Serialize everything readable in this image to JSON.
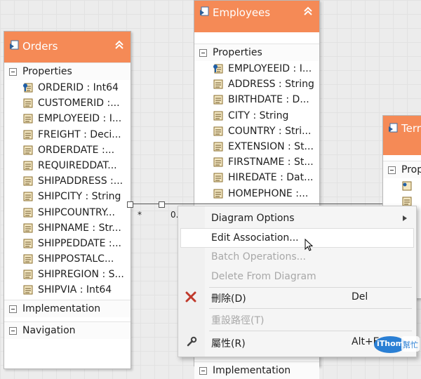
{
  "orders": {
    "title": "Orders",
    "properties_label": "Properties",
    "properties": [
      {
        "text": "ORDERID : Int64",
        "key": true
      },
      {
        "text": "CUSTOMERID  :...",
        "key": false
      },
      {
        "text": "EMPLOYEEID : I...",
        "key": false
      },
      {
        "text": "FREIGHT : Deci...",
        "key": false
      },
      {
        "text": "ORDERDATE  :...",
        "key": false
      },
      {
        "text": "REQUIREDDAT...",
        "key": false
      },
      {
        "text": "SHIPADDRESS  :...",
        "key": false
      },
      {
        "text": "SHIPCITY : String",
        "key": false
      },
      {
        "text": "SHIPCOUNTRY...",
        "key": false
      },
      {
        "text": "SHIPNAME : Str...",
        "key": false
      },
      {
        "text": "SHIPPEDDATE  :...",
        "key": false
      },
      {
        "text": "SHIPPOSTALC...",
        "key": false
      },
      {
        "text": "SHIPREGION : S...",
        "key": false
      },
      {
        "text": "SHIPVIA : Int64",
        "key": false
      }
    ],
    "implementation_label": "Implementation",
    "navigation_label": "Navigation"
  },
  "employees": {
    "title": "Employees",
    "properties_label": "Properties",
    "properties": [
      {
        "text": "EMPLOYEEID : I...",
        "key": true
      },
      {
        "text": "ADDRESS : String",
        "key": false
      },
      {
        "text": "BIRTHDATE  : D...",
        "key": false
      },
      {
        "text": "CITY : String",
        "key": false
      },
      {
        "text": "COUNTRY : Stri...",
        "key": false
      },
      {
        "text": "EXTENSION : St...",
        "key": false
      },
      {
        "text": "FIRSTNAME : St...",
        "key": false
      },
      {
        "text": "HIREDATE : Dat...",
        "key": false
      },
      {
        "text": "HOMEPHONE  :...",
        "key": false
      }
    ],
    "implementation_label": "Implementation"
  },
  "territories": {
    "title": "Terr",
    "properties_label": "Prop"
  },
  "association": {
    "left_multiplicity": "*",
    "right_multiplicity": "0..1"
  },
  "context_menu": {
    "items": [
      {
        "label": "Diagram Options",
        "enabled": true,
        "submenu": true
      },
      {
        "label": "Edit Association...",
        "enabled": true,
        "highlighted": true
      },
      {
        "label": "Batch Operations...",
        "enabled": false
      },
      {
        "label": "Delete From Diagram",
        "enabled": false
      },
      {
        "label": "刪除(D)",
        "shortcut": "Del",
        "enabled": true,
        "icon": "red-x-delete-icon"
      },
      {
        "label": "重設路徑(T)",
        "enabled": false
      },
      {
        "label": "屬性(R)",
        "shortcut": "Alt+E",
        "enabled": true,
        "icon": "wrench-icon"
      }
    ]
  },
  "watermark": {
    "text": "iThome",
    "subtext": "幫忙"
  },
  "colors": {
    "header": "#f58a56",
    "menu_bg": "#f5f5f5",
    "delete_icon": "#c0392b"
  }
}
